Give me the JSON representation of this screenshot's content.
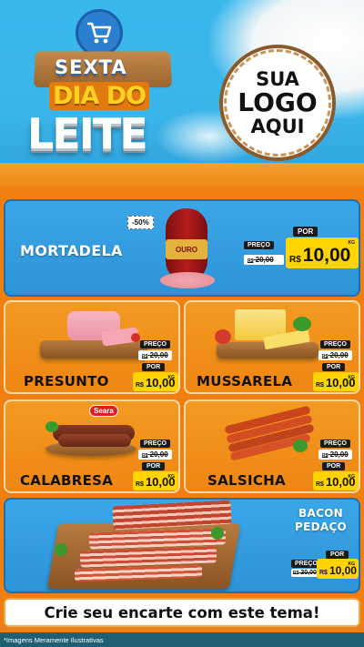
{
  "header": {
    "title_line1": "SEXTA",
    "title_line2": "DIA DO",
    "title_line3": "LEITE",
    "logo_line1": "SUA",
    "logo_line2": "LOGO",
    "logo_line3": "AQUI"
  },
  "featured": {
    "name": "MORTADELA",
    "discount": "-50%",
    "product_brand": "OURO",
    "preco_label": "PREÇO",
    "old_currency": "R$",
    "old_price": "20,00",
    "por_label": "POR",
    "currency": "R$",
    "price": "10,00",
    "unit": "KG"
  },
  "products": [
    {
      "name": "PRESUNTO",
      "preco_label": "PREÇO",
      "old_currency": "R$",
      "old_price": "20,00",
      "por_label": "POR",
      "currency": "R$",
      "price": "10,00",
      "unit": "KG"
    },
    {
      "name": "MUSSARELA",
      "preco_label": "PREÇO",
      "old_currency": "R$",
      "old_price": "20,00",
      "por_label": "POR",
      "currency": "R$",
      "price": "10,00",
      "unit": "KG"
    },
    {
      "name": "CALABRESA",
      "brand": "Seara",
      "preco_label": "PREÇO",
      "old_currency": "R$",
      "old_price": "20,00",
      "por_label": "POR",
      "currency": "R$",
      "price": "10,00",
      "unit": "KG"
    },
    {
      "name": "SALSICHA",
      "preco_label": "PREÇO",
      "old_currency": "R$",
      "old_price": "20,00",
      "por_label": "POR",
      "currency": "R$",
      "price": "10,00",
      "unit": "KG"
    }
  ],
  "bacon": {
    "name_line1": "BACON",
    "name_line2": "PEDAÇO",
    "preco_label": "PREÇO",
    "old_currency": "R$",
    "old_price": "20,00",
    "por_label": "POR",
    "currency": "R$",
    "price": "10,00",
    "unit": "KG"
  },
  "footer": {
    "cta": "Crie seu encarte com este tema!",
    "disclaimer": "*Imagens Meramente Ilustrativas"
  },
  "colors": {
    "blue_card": "#2d93d8",
    "orange_card": "#ee8612",
    "price_yellow": "#ffd400",
    "disclaimer_bar": "#1e5f74"
  }
}
